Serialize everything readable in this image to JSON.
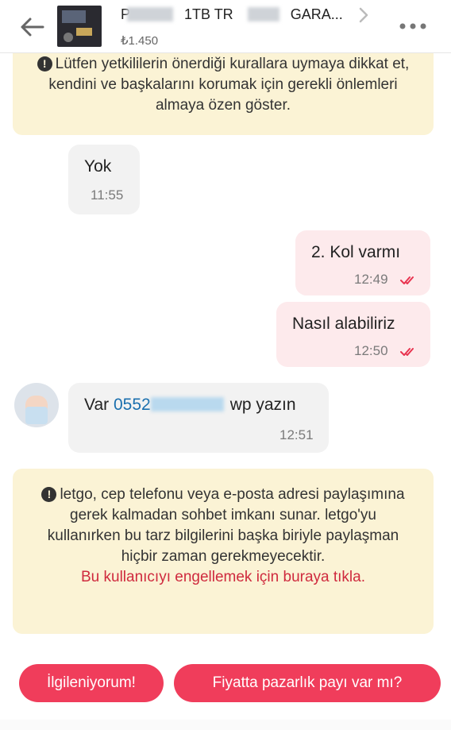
{
  "header": {
    "title": "P▒▒▒▒▒ 1TB TR ▒▒▒▒ GARA...",
    "title_visible": "1TB TR",
    "title_tail": "GARA...",
    "price": "₺1.450"
  },
  "notice_top": {
    "text": "Lütfen yetkililerin önerdiği kurallara uymaya dikkat et, kendini ve başkalarını korumak için gerekli önlemleri almaya özen göster."
  },
  "messages": [
    {
      "side": "in",
      "text": "Yok",
      "time": "11:55"
    },
    {
      "side": "out",
      "text": "2. Kol varmı",
      "time": "12:49"
    },
    {
      "side": "out",
      "text": "Nasıl alabiliriz",
      "time": "12:50"
    },
    {
      "side": "in",
      "text_prefix": "Var",
      "phone": "0552",
      "text_suffix": "wp yazın",
      "time": "12:51"
    }
  ],
  "notice_bottom": {
    "text": "letgo, cep telefonu veya e-posta adresi paylaşımına gerek kalmadan sohbet imkanı sunar. letgo'yu kullanırken bu tarz bilgilerini başka biriyle paylaşman hiçbir zaman gerekmeyecektir.",
    "link": "Bu kullanıcıyı engellemek için buraya tıkla."
  },
  "quick_replies": [
    "İlgileniyorum!",
    "Fiyatta pazarlık payı var mı?"
  ],
  "colors": {
    "accent": "#f03d5b",
    "notice_bg": "#fbf3d5",
    "incoming_bg": "#f2f2f2",
    "outgoing_bg": "#fdeaec",
    "link": "#cf2a3e",
    "phone": "#1a6fae"
  },
  "icons": [
    "back-arrow-icon",
    "chevron-right-icon",
    "more-dots-icon",
    "warning-icon",
    "double-check-icon"
  ]
}
